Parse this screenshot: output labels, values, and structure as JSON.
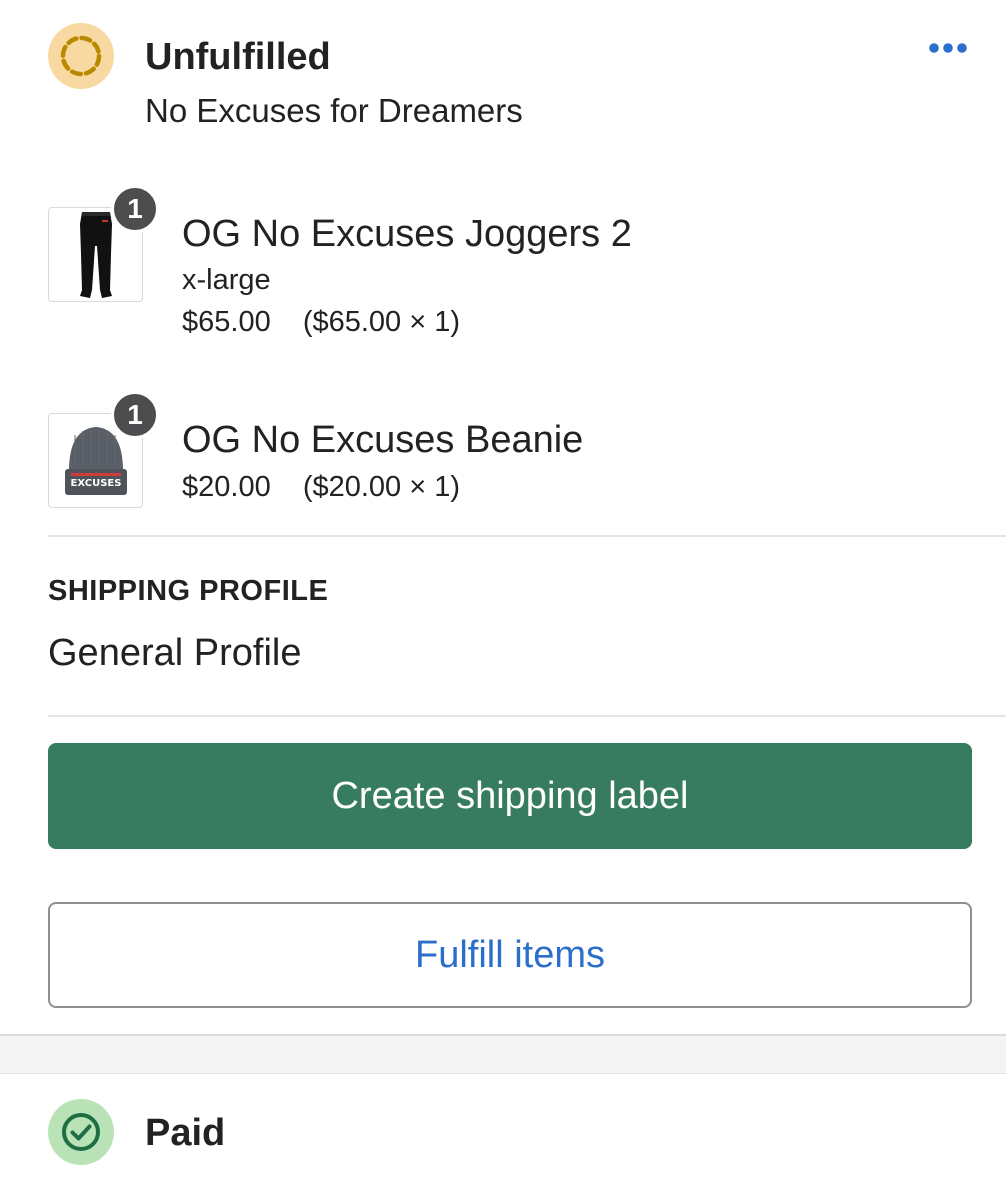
{
  "fulfillment": {
    "status": "Unfulfilled",
    "location": "No Excuses for Dreamers",
    "status_icon": "unfulfilled-dashed-circle-icon",
    "more_icon": "more-horizontal-icon",
    "colors": {
      "status_bg": "#f8d9a1",
      "status_stroke": "#b98900",
      "more": "#2c6ecb"
    }
  },
  "items": [
    {
      "name": "OG No Excuses Joggers 2",
      "variant": "x-large",
      "price": "$65.00",
      "breakdown": "($65.00 × 1)",
      "quantity": "1",
      "thumbnail_icon": "joggers-image"
    },
    {
      "name": "OG No Excuses Beanie",
      "price": "$20.00",
      "breakdown": "($20.00 × 1)",
      "quantity": "1",
      "thumbnail_icon": "beanie-image",
      "thumbnail_text": "EXCUSES"
    }
  ],
  "shipping": {
    "label": "SHIPPING PROFILE",
    "profile": "General Profile"
  },
  "actions": {
    "create_label": "Create shipping label",
    "fulfill": "Fulfill items",
    "colors": {
      "primary_bg": "#377b60",
      "link": "#2c6ecb"
    }
  },
  "payment": {
    "status": "Paid",
    "status_icon": "check-circle-icon",
    "colors": {
      "status_bg": "#b9e3b6",
      "status_stroke": "#1f6e43"
    }
  }
}
